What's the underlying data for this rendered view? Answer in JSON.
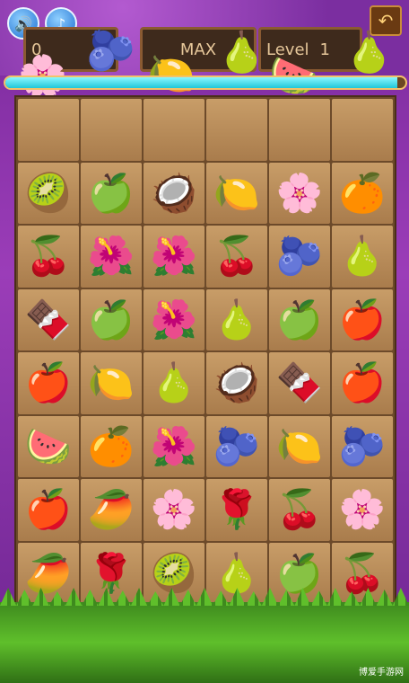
{
  "hud": {
    "panel_left": "0",
    "panel_mid": "MAX",
    "panel_right_label": "Level",
    "panel_right_value": "1",
    "panel_far": "1",
    "progress": 0.98
  },
  "icons": {
    "sound": "speaker-icon",
    "music": "music-note-icon",
    "back": "back-arrow-icon"
  },
  "floating": [
    "🫐",
    "🌸",
    "🍋",
    "🍐",
    "🍉",
    "🍐"
  ],
  "board": [
    [
      "",
      "",
      "",
      "",
      "",
      ""
    ],
    [
      "🥝",
      "🍏",
      "🥥",
      "🍋",
      "🌸",
      "🍊"
    ],
    [
      "🍒",
      "🌺",
      "🌺",
      "🍒",
      "🫐",
      "🍐"
    ],
    [
      "🍫",
      "🍏",
      "🌺",
      "🍐",
      "🍏",
      "🍎"
    ],
    [
      "🍎",
      "🍋",
      "🍐",
      "🥥",
      "🍫",
      "🍎"
    ],
    [
      "🍉",
      "🍊",
      "🌺",
      "🫐",
      "🍋",
      "🫐"
    ],
    [
      "🍎",
      "🥭",
      "🌸",
      "🌹",
      "🍒",
      "🌸"
    ],
    [
      "🥭",
      "🌹",
      "🥝",
      "🍐",
      "🍏",
      "🍒"
    ]
  ],
  "watermark": "博爱手游网"
}
